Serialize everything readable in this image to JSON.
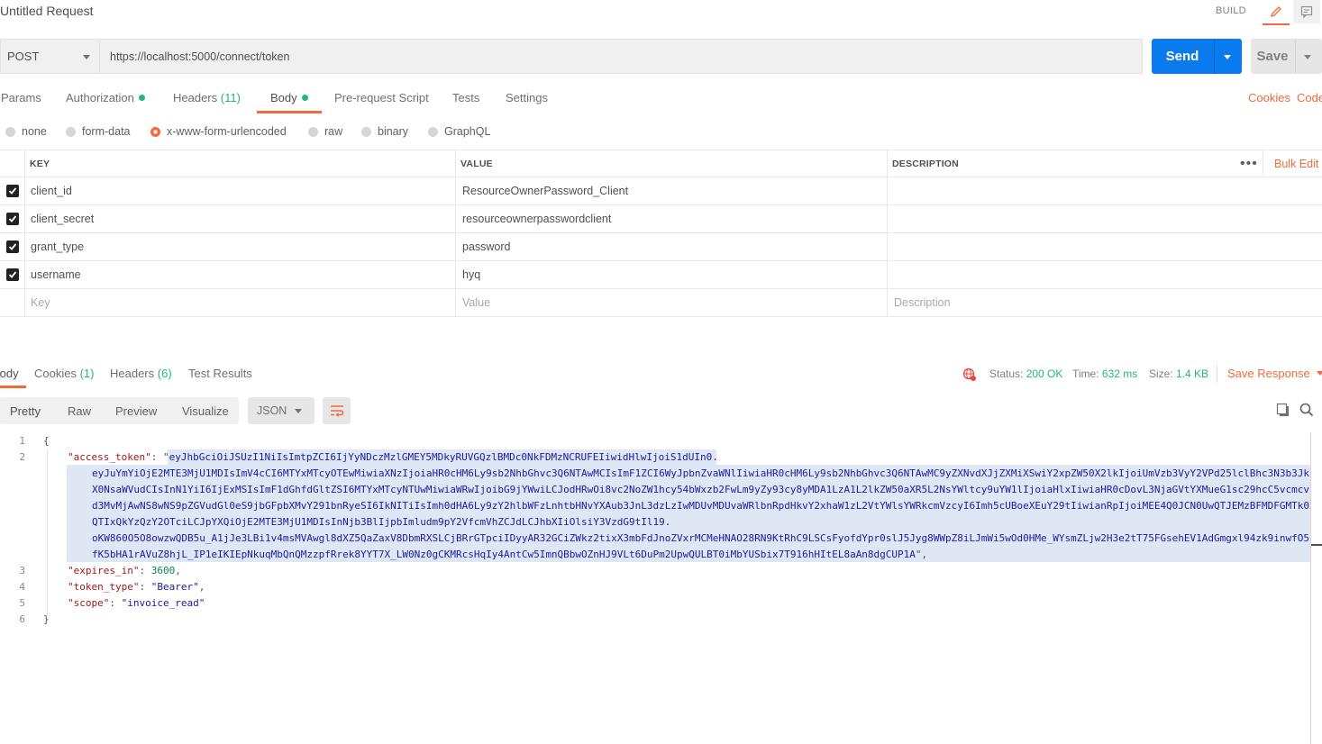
{
  "header": {
    "title": "Untitled Request",
    "build_label": "BUILD"
  },
  "request": {
    "method": "POST",
    "url": "https://localhost:5000/connect/token",
    "send_label": "Send",
    "save_label": "Save"
  },
  "tabs": {
    "params": "Params",
    "authorization": "Authorization",
    "headers": "Headers",
    "headers_count": "(11)",
    "body": "Body",
    "prerequest": "Pre-request Script",
    "tests": "Tests",
    "settings": "Settings",
    "cookies": "Cookies",
    "code": "Code"
  },
  "body_types": {
    "none": "none",
    "form_data": "form-data",
    "urlencoded": "x-www-form-urlencoded",
    "raw": "raw",
    "binary": "binary",
    "graphql": "GraphQL",
    "selected": "x-www-form-urlencoded"
  },
  "table": {
    "headers": {
      "key": "KEY",
      "value": "VALUE",
      "description": "DESCRIPTION"
    },
    "bulk_edit": "Bulk Edit",
    "more": "•••",
    "rows": [
      {
        "key": "client_id",
        "value": "ResourceOwnerPassword_Client",
        "description": "",
        "checked": true
      },
      {
        "key": "client_secret",
        "value": "resourceownerpasswordclient",
        "description": "",
        "checked": true
      },
      {
        "key": "grant_type",
        "value": "password",
        "description": "",
        "checked": true
      },
      {
        "key": "username",
        "value": "hyq",
        "description": "",
        "checked": true
      }
    ],
    "placeholder": {
      "key": "Key",
      "value": "Value",
      "description": "Description"
    }
  },
  "response": {
    "tabs": {
      "body": "Body",
      "cookies": "Cookies",
      "cookies_count": "(1)",
      "headers": "Headers",
      "headers_count": "(6)",
      "test_results": "Test Results"
    },
    "status_label": "Status:",
    "status_value": "200 OK",
    "time_label": "Time:",
    "time_value": "632 ms",
    "size_label": "Size:",
    "size_value": "1.4 KB",
    "save_response": "Save Response",
    "formats": {
      "pretty": "Pretty",
      "raw": "Raw",
      "preview": "Preview",
      "visualize": "Visualize"
    },
    "language": "JSON",
    "line_numbers": [
      "1",
      "2",
      "3",
      "4",
      "5",
      "6"
    ],
    "code": {
      "open_brace": "{",
      "close_brace": "}",
      "access_token_key": "\"access_token\"",
      "access_token_lines": [
        "eyJhbGciOiJSUzI1NiIsImtpZCI6IjYyNDczMzlGMEY5MDkyRUVGQzlBMDc0NkFDMzNCRUFEIiwidHlwIjoiS1dUIn0.",
        "eyJuYmYiOjE2MTE3MjU1MDIsImV4cCI6MTYxMTcyOTEwMiwiaXNzIjoiaHR0cHM6Ly9sb2NhbGhvc3Q6NTAwMCIsImF1ZCI6WyJpbnZvaWNlIiwiaHR0cHM6Ly9sb2NhbGhvc3Q6NTAwMC9yZXNvdXJjZXMiXSwiY2xpZW50X2lkIjoiUmVzb3VyY2VPd25lclBhc3N3b3Jk",
        "X0NsaWVudCIsInN1YiI6IjExMSIsImF1dGhfdGltZSI6MTYxMTcyNTUwMiwiaWRwIjoibG9jYWwiLCJodHRwOi8vc2NoZW1hcy54bWxzb2FwLm9yZy93cy8yMDA1LzA1L2lkZW50aXR5L2NsYWltcy9uYW1lIjoiaHlxIiwiaHR0cDovL3NjaGVtYXMueG1sc29hcC5vcmcv",
        "d3MvMjAwNS8wNS9pZGVudGl0eS9jbGFpbXMvY291bnRyeSI6IkNITiIsImh0dHA6Ly9zY2hlbWFzLnhtbHNvYXAub3JnL3dzLzIwMDUvMDUvaWRlbnRpdHkvY2xhaW1zL2VtYWlsYWRkcmVzcyI6Imh5cUBoeXEuY29tIiwianRpIjoiMEE4Q0JCN0UwQTJEMzBFMDFGMTk0",
        "QTIxQkYzQzY2OTciLCJpYXQiOjE2MTE3MjU1MDIsInNjb3BlIjpbImludm9pY2VfcmVhZCJdLCJhbXIiOlsiY3VzdG9tIl19.",
        "oKW860O5O8owzwQDB5u_A1jJe3LBi1v4msMVAwgl8dXZ5QaZaxV8DbmRXSLCjBRrGTpciIDyyAR32GCiZWkz2tixX3mbFdJnoZVxrMCMeHNAO28RN9KtRhC9LSCsFyofdYpr0slJ5Jyg8WWpZ8iLJmWi5wOd0HMe_WYsmZLjw2H3e2tT75FGsehEV1AdGmgxl94zk9inwfO5",
        "fK5bHA1rAVuZ8hjL_IP1eIKIEpNkuqMbQnQMzzpfRrek8YYT7X_LW0Nz0gCKMRcsHqIy4AntCw5ImnQBbwOZnHJ9VLt6DuPm2UpwQULBT0iMbYUSbix7T916hHItEL8aAn8dgCUP1A"
      ],
      "expires_in_key": "\"expires_in\"",
      "expires_in_value": "3600",
      "token_type_key": "\"token_type\"",
      "token_type_value": "\"Bearer\"",
      "scope_key": "\"scope\"",
      "scope_value": "\"invoice_read\""
    }
  },
  "colors": {
    "accent": "#f26b3a",
    "send": "#097bed",
    "success": "#26b47f"
  }
}
